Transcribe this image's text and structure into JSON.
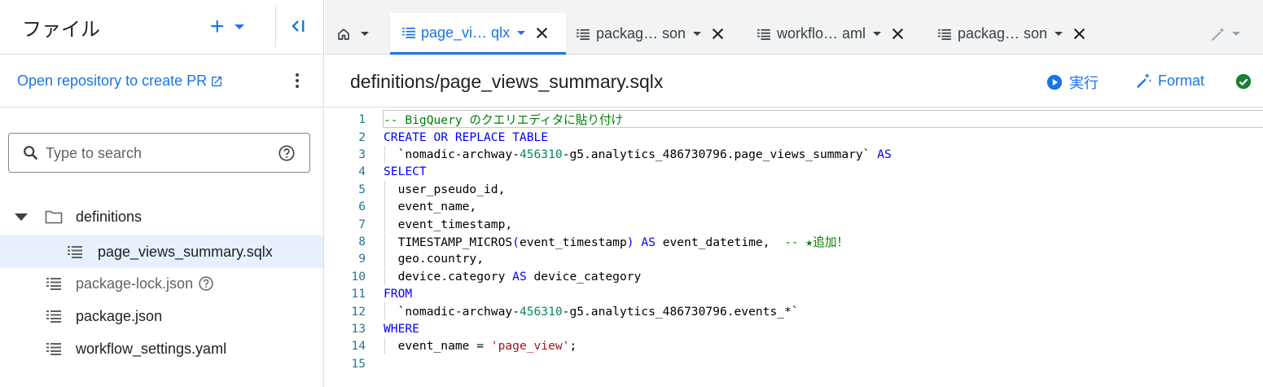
{
  "sidebar": {
    "title": "ファイル",
    "repo_link": "Open repository to create PR",
    "search": {
      "placeholder": "Type to search"
    },
    "tree": [
      {
        "label": "definitions",
        "type": "folder"
      },
      {
        "label": "page_views_summary.sqlx",
        "type": "file"
      },
      {
        "label": "package-lock.json",
        "type": "file"
      },
      {
        "label": "package.json",
        "type": "file"
      },
      {
        "label": "workflow_settings.yaml",
        "type": "file"
      }
    ]
  },
  "tabs": [
    {
      "label": "page_vi… qlx",
      "active": true
    },
    {
      "label": "packag… son",
      "active": false
    },
    {
      "label": "workflo… aml",
      "active": false
    },
    {
      "label": "packag… son",
      "active": false
    }
  ],
  "editor": {
    "file_path": "definitions/page_views_summary.sqlx",
    "run_label": "実行",
    "format_label": "Format",
    "line_numbers": [
      "1",
      "2",
      "3",
      "4",
      "5",
      "6",
      "7",
      "8",
      "9",
      "10",
      "11",
      "12",
      "13",
      "14",
      "15"
    ],
    "code": {
      "l1": "-- BigQuery のクエリエディタに貼り付け",
      "l2a": "CREATE OR REPLACE TABLE",
      "l3a": "  `nomadic-archway-",
      "l3b": "456310",
      "l3c": "-g5.analytics_486730796.page_views_summary` ",
      "l3d": "AS",
      "l4": "SELECT",
      "l5": "  user_pseudo_id,",
      "l6": "  event_name,",
      "l7": "  event_timestamp,",
      "l8a": "  TIMESTAMP_MICROS",
      "l8b": "(",
      "l8c": "event_timestamp",
      "l8d": ")",
      "l8e": " AS ",
      "l8f": "event_datetime,  ",
      "l8g": "-- ★追加！",
      "l9": "  geo.country,",
      "l10a": "  device.category ",
      "l10b": "AS",
      "l10c": " device_category",
      "l11": "FROM",
      "l12a": "  `nomadic-archway-",
      "l12b": "456310",
      "l12c": "-g5.analytics_486730796.events_*`",
      "l13": "WHERE",
      "l14a": "  event_name = ",
      "l14b": "'page_view'",
      "l14c": ";"
    }
  },
  "colors": {
    "accent": "#1a73e8",
    "keyword": "#0000ff",
    "comment": "#008000",
    "number": "#098658",
    "string": "#a31515",
    "success": "#188038"
  }
}
